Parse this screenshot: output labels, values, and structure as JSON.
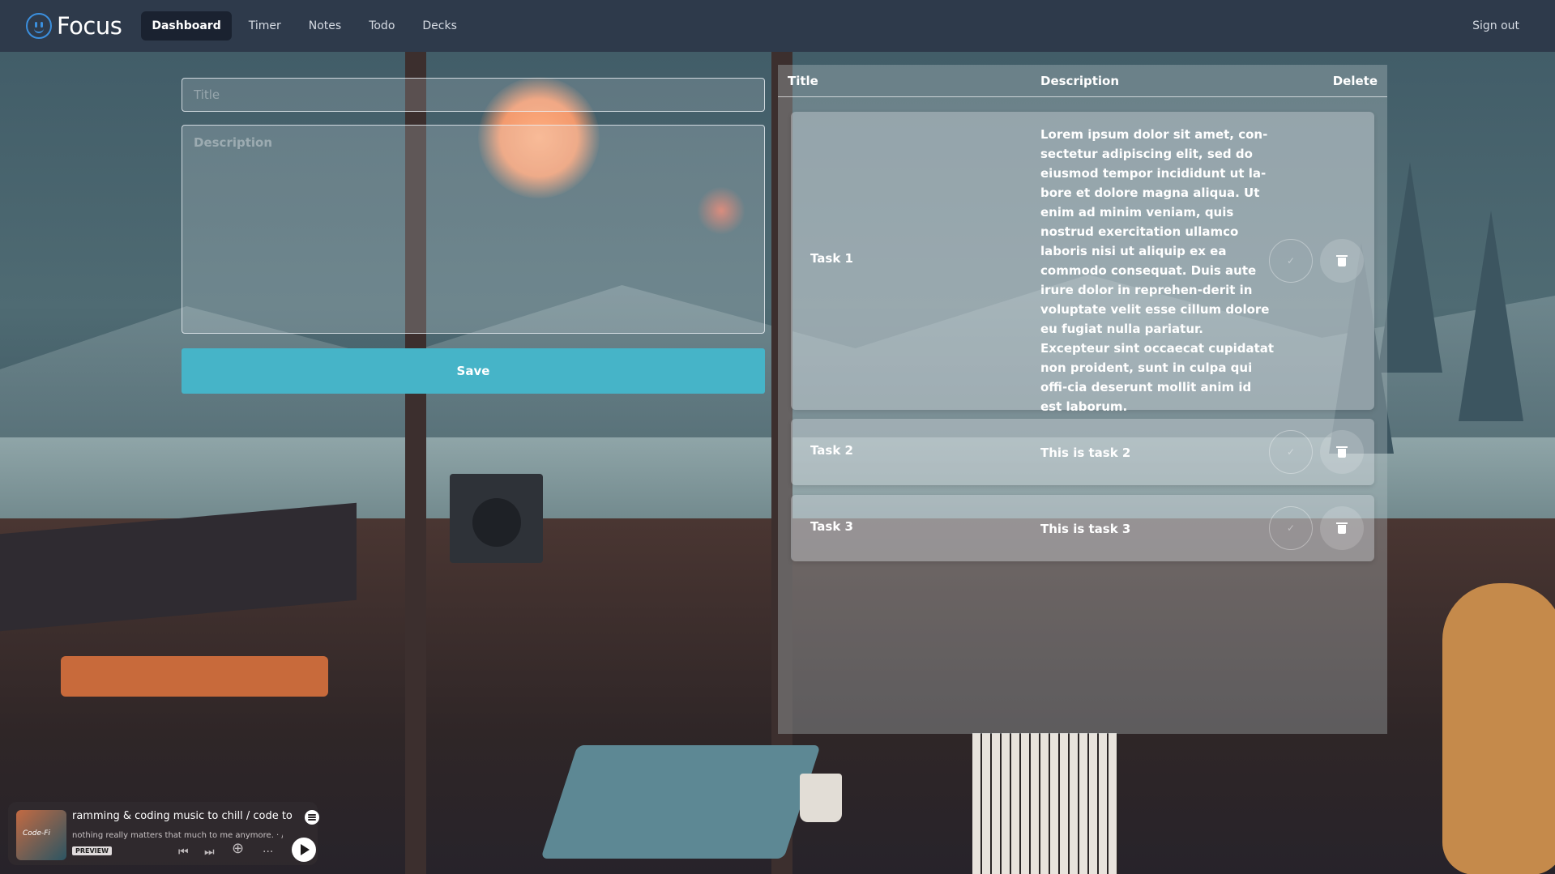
{
  "app": {
    "brand": "Focus"
  },
  "nav": {
    "links": [
      {
        "label": "Dashboard",
        "active": true
      },
      {
        "label": "Timer",
        "active": false
      },
      {
        "label": "Notes",
        "active": false
      },
      {
        "label": "Todo",
        "active": false
      },
      {
        "label": "Decks",
        "active": false
      }
    ],
    "sign_out": "Sign out"
  },
  "form": {
    "title_placeholder": "Title",
    "title_value": "",
    "description_placeholder": "Description",
    "description_value": "",
    "save_label": "Save"
  },
  "todo": {
    "columns": {
      "title": "Title",
      "description": "Description",
      "delete": "Delete"
    },
    "rows": [
      {
        "title": "Task 1",
        "description": "Lorem ipsum dolor sit amet, con-sectetur adipiscing elit, sed do eiusmod tempor incididunt ut la-bore et dolore magna aliqua. Ut enim ad minim veniam, quis nostrud exercitation ullamco laboris nisi ut aliquip ex ea commodo consequat. Duis aute irure dolor in reprehen-derit in voluptate velit esse cillum dolore eu fugiat nulla pariatur. Excepteur sint occaecat cupidatat non proident, sunt in culpa qui offi-cia deserunt mollit anim id est laborum.",
        "check_icon": "check-icon",
        "delete_icon": "trash-icon"
      },
      {
        "title": "Task 2",
        "description": "This is task 2",
        "check_icon": "check-icon",
        "delete_icon": "trash-icon"
      },
      {
        "title": "Task 3",
        "description": "This is task 3",
        "check_icon": "check-icon",
        "delete_icon": "trash-icon"
      }
    ]
  },
  "player": {
    "cover_text": "Code-Fi",
    "track": "ramming & coding music to chill / code to",
    "artist": "nothing really matters that much to me anymore. · /",
    "badge": "PREVIEW"
  },
  "colors": {
    "nav_bg": "#2e3a4b",
    "accent": "#46b4c8",
    "brand_icon": "#3b8fde"
  }
}
